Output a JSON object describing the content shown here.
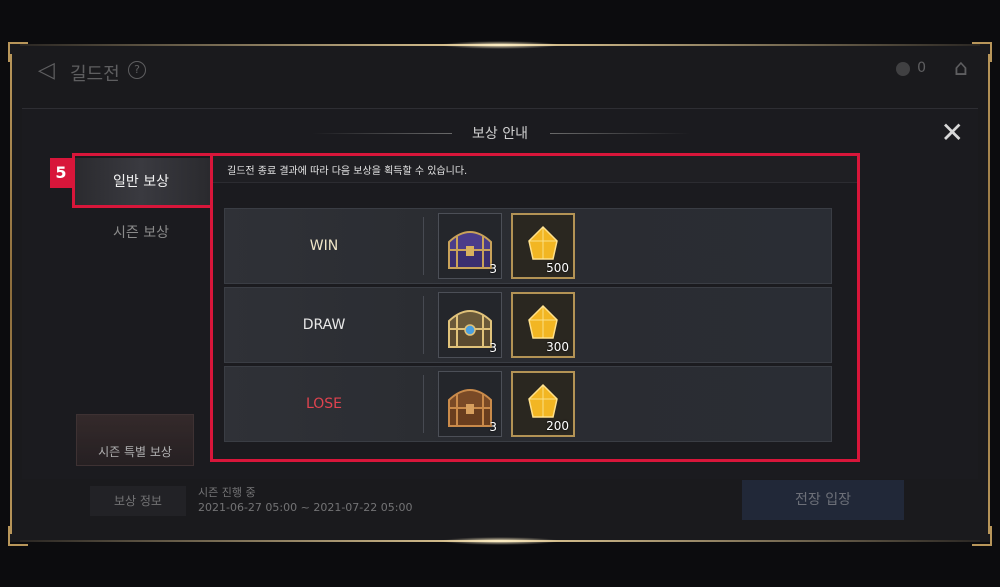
{
  "header": {
    "title": "길드전",
    "help_glyph": "?",
    "coin_count": "0"
  },
  "modal": {
    "title": "보상 안내",
    "close_glyph": "✕",
    "description": "길드전 종료 결과에 따라 다음 보상을 획득할 수 있습니다."
  },
  "tabs": {
    "general": "일반 보상",
    "season": "시즌 보상",
    "season_special": "시즌 특별 보상"
  },
  "step_badge": "5",
  "rewards": [
    {
      "result": "WIN",
      "result_color": "#f0e6c8",
      "box_count": "3",
      "gem_count": "500",
      "box_icon": "purple-treasure-chest-icon"
    },
    {
      "result": "DRAW",
      "result_color": "#e8e8e8",
      "box_count": "3",
      "gem_count": "300",
      "box_icon": "ornate-treasure-chest-icon"
    },
    {
      "result": "LOSE",
      "result_color": "#e0434f",
      "box_count": "3",
      "gem_count": "200",
      "box_icon": "wooden-treasure-chest-icon"
    }
  ],
  "bottom": {
    "reward_info": "보상 정보",
    "season_status": "시즌 진행 중",
    "season_dates": "2021-06-27 05:00 ~ 2021-07-22 05:00",
    "enter_battlefield": "전장 입장"
  },
  "colors": {
    "highlight": "#d8163a",
    "gold_frame": "#b8965a",
    "gem": "#f2b623"
  }
}
